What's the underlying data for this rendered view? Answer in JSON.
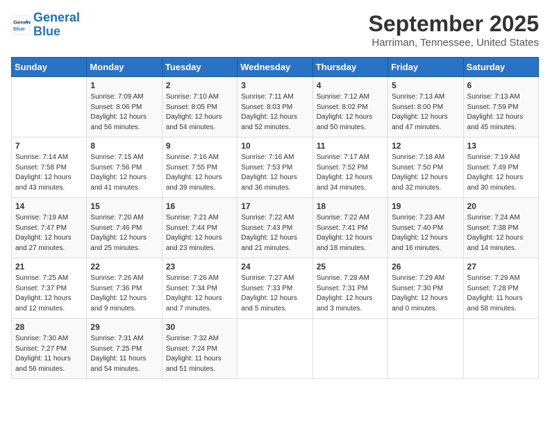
{
  "header": {
    "logo": {
      "line1": "General",
      "line2": "Blue"
    },
    "title": "September 2025",
    "location": "Harriman, Tennessee, United States"
  },
  "days_of_week": [
    "Sunday",
    "Monday",
    "Tuesday",
    "Wednesday",
    "Thursday",
    "Friday",
    "Saturday"
  ],
  "weeks": [
    [
      {
        "day": "",
        "info": ""
      },
      {
        "day": "1",
        "info": "Sunrise: 7:09 AM\nSunset: 8:06 PM\nDaylight: 12 hours\nand 56 minutes."
      },
      {
        "day": "2",
        "info": "Sunrise: 7:10 AM\nSunset: 8:05 PM\nDaylight: 12 hours\nand 54 minutes."
      },
      {
        "day": "3",
        "info": "Sunrise: 7:11 AM\nSunset: 8:03 PM\nDaylight: 12 hours\nand 52 minutes."
      },
      {
        "day": "4",
        "info": "Sunrise: 7:12 AM\nSunset: 8:02 PM\nDaylight: 12 hours\nand 50 minutes."
      },
      {
        "day": "5",
        "info": "Sunrise: 7:13 AM\nSunset: 8:00 PM\nDaylight: 12 hours\nand 47 minutes."
      },
      {
        "day": "6",
        "info": "Sunrise: 7:13 AM\nSunset: 7:59 PM\nDaylight: 12 hours\nand 45 minutes."
      }
    ],
    [
      {
        "day": "7",
        "info": "Sunrise: 7:14 AM\nSunset: 7:58 PM\nDaylight: 12 hours\nand 43 minutes."
      },
      {
        "day": "8",
        "info": "Sunrise: 7:15 AM\nSunset: 7:56 PM\nDaylight: 12 hours\nand 41 minutes."
      },
      {
        "day": "9",
        "info": "Sunrise: 7:16 AM\nSunset: 7:55 PM\nDaylight: 12 hours\nand 39 minutes."
      },
      {
        "day": "10",
        "info": "Sunrise: 7:16 AM\nSunset: 7:53 PM\nDaylight: 12 hours\nand 36 minutes."
      },
      {
        "day": "11",
        "info": "Sunrise: 7:17 AM\nSunset: 7:52 PM\nDaylight: 12 hours\nand 34 minutes."
      },
      {
        "day": "12",
        "info": "Sunrise: 7:18 AM\nSunset: 7:50 PM\nDaylight: 12 hours\nand 32 minutes."
      },
      {
        "day": "13",
        "info": "Sunrise: 7:19 AM\nSunset: 7:49 PM\nDaylight: 12 hours\nand 30 minutes."
      }
    ],
    [
      {
        "day": "14",
        "info": "Sunrise: 7:19 AM\nSunset: 7:47 PM\nDaylight: 12 hours\nand 27 minutes."
      },
      {
        "day": "15",
        "info": "Sunrise: 7:20 AM\nSunset: 7:46 PM\nDaylight: 12 hours\nand 25 minutes."
      },
      {
        "day": "16",
        "info": "Sunrise: 7:21 AM\nSunset: 7:44 PM\nDaylight: 12 hours\nand 23 minutes."
      },
      {
        "day": "17",
        "info": "Sunrise: 7:22 AM\nSunset: 7:43 PM\nDaylight: 12 hours\nand 21 minutes."
      },
      {
        "day": "18",
        "info": "Sunrise: 7:22 AM\nSunset: 7:41 PM\nDaylight: 12 hours\nand 18 minutes."
      },
      {
        "day": "19",
        "info": "Sunrise: 7:23 AM\nSunset: 7:40 PM\nDaylight: 12 hours\nand 16 minutes."
      },
      {
        "day": "20",
        "info": "Sunrise: 7:24 AM\nSunset: 7:38 PM\nDaylight: 12 hours\nand 14 minutes."
      }
    ],
    [
      {
        "day": "21",
        "info": "Sunrise: 7:25 AM\nSunset: 7:37 PM\nDaylight: 12 hours\nand 12 minutes."
      },
      {
        "day": "22",
        "info": "Sunrise: 7:26 AM\nSunset: 7:36 PM\nDaylight: 12 hours\nand 9 minutes."
      },
      {
        "day": "23",
        "info": "Sunrise: 7:26 AM\nSunset: 7:34 PM\nDaylight: 12 hours\nand 7 minutes."
      },
      {
        "day": "24",
        "info": "Sunrise: 7:27 AM\nSunset: 7:33 PM\nDaylight: 12 hours\nand 5 minutes."
      },
      {
        "day": "25",
        "info": "Sunrise: 7:28 AM\nSunset: 7:31 PM\nDaylight: 12 hours\nand 3 minutes."
      },
      {
        "day": "26",
        "info": "Sunrise: 7:29 AM\nSunset: 7:30 PM\nDaylight: 12 hours\nand 0 minutes."
      },
      {
        "day": "27",
        "info": "Sunrise: 7:29 AM\nSunset: 7:28 PM\nDaylight: 11 hours\nand 58 minutes."
      }
    ],
    [
      {
        "day": "28",
        "info": "Sunrise: 7:30 AM\nSunset: 7:27 PM\nDaylight: 11 hours\nand 56 minutes."
      },
      {
        "day": "29",
        "info": "Sunrise: 7:31 AM\nSunset: 7:25 PM\nDaylight: 11 hours\nand 54 minutes."
      },
      {
        "day": "30",
        "info": "Sunrise: 7:32 AM\nSunset: 7:24 PM\nDaylight: 11 hours\nand 51 minutes."
      },
      {
        "day": "",
        "info": ""
      },
      {
        "day": "",
        "info": ""
      },
      {
        "day": "",
        "info": ""
      },
      {
        "day": "",
        "info": ""
      }
    ]
  ]
}
